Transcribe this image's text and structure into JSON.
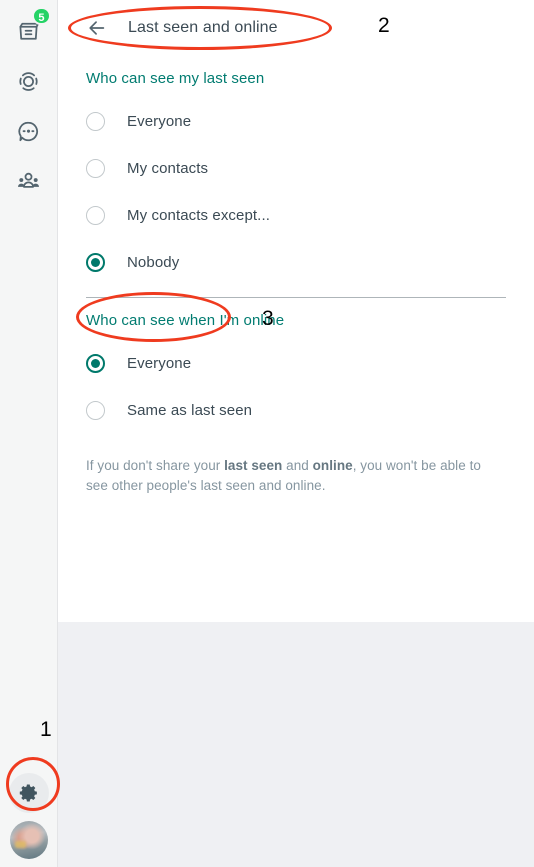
{
  "nav": {
    "items": [
      {
        "name": "chats-icon",
        "label": "Chats",
        "badge": "5"
      },
      {
        "name": "status-icon",
        "label": "Status",
        "badge": ""
      },
      {
        "name": "channels-icon",
        "label": "Channels",
        "badge": ""
      },
      {
        "name": "communities-icon",
        "label": "Communities",
        "badge": ""
      }
    ],
    "settings_label": "Settings",
    "profile_label": "Profile"
  },
  "header": {
    "back_label": "Back",
    "title": "Last seen and online"
  },
  "sections": [
    {
      "title": "Who can see my last seen",
      "options": [
        {
          "label": "Everyone",
          "selected": false
        },
        {
          "label": "My contacts",
          "selected": false
        },
        {
          "label": "My contacts except...",
          "selected": false
        },
        {
          "label": "Nobody",
          "selected": true
        }
      ]
    },
    {
      "title": "Who can see when I'm online",
      "options": [
        {
          "label": "Everyone",
          "selected": true
        },
        {
          "label": "Same as last seen",
          "selected": false
        }
      ]
    }
  ],
  "footnote": {
    "part1": "If you don't share your ",
    "bold1": "last seen",
    "part2": " and ",
    "bold2": "online",
    "part3": ", you won't be able to see other people's last seen and online."
  },
  "annotations": [
    {
      "number": "1",
      "target": "settings-button"
    },
    {
      "number": "2",
      "target": "panel-header"
    },
    {
      "number": "3",
      "target": "option-nobody"
    }
  ],
  "colors": {
    "accent_teal": "#027c71",
    "radio_selected": "#00796b",
    "badge_green": "#25d366",
    "annotation_red": "#ef3b1f",
    "text_primary": "#3b4a54",
    "text_muted": "#8696a0"
  }
}
